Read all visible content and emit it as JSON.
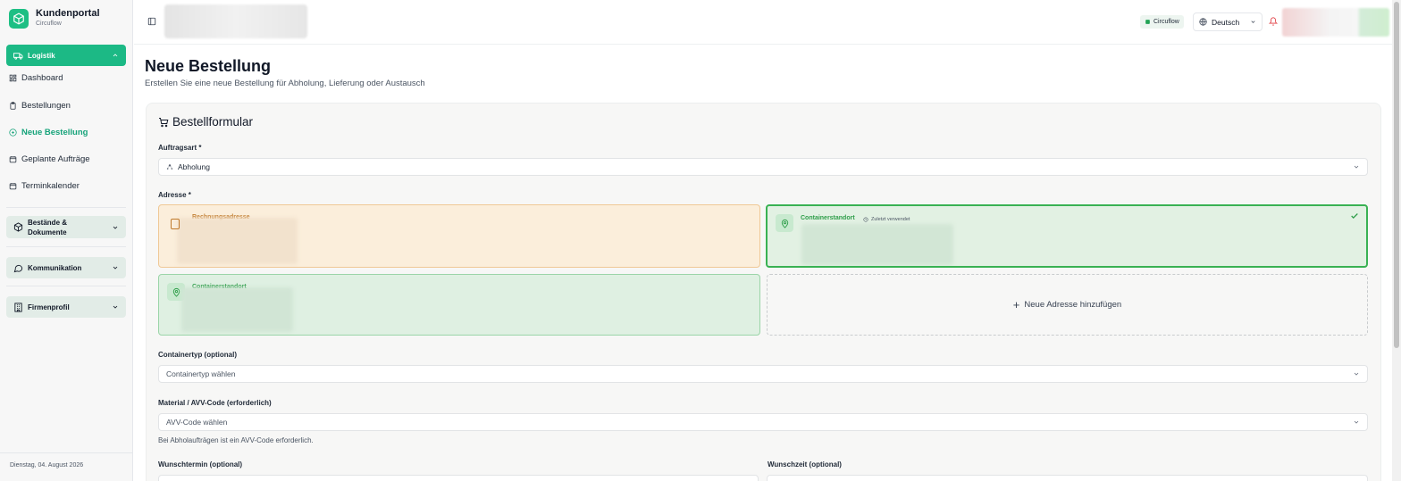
{
  "app": {
    "title": "Kundenportal",
    "subtitle": "Circuflow"
  },
  "sidebar": {
    "logistik_label": "Logistik",
    "items": [
      {
        "label": "Dashboard",
        "icon": "dashboard-icon"
      },
      {
        "label": "Bestellungen",
        "icon": "clipboard-icon"
      },
      {
        "label": "Neue Bestellung",
        "icon": "plus-circle-icon",
        "active": true
      },
      {
        "label": "Geplante Aufträge",
        "icon": "calendar-icon"
      },
      {
        "label": "Terminkalender",
        "icon": "calendar-icon"
      }
    ],
    "groups": [
      {
        "label": "Bestände & Dokumente",
        "line1": "Bestände &",
        "line2": "Dokumente",
        "icon": "box-icon"
      },
      {
        "label": "Kommunikation",
        "icon": "chat-icon"
      },
      {
        "label": "Firmenprofil",
        "icon": "building-icon"
      }
    ],
    "footer_date": "Dienstag, 04. August 2026"
  },
  "header": {
    "org_badge": "Circuflow",
    "language": "Deutsch"
  },
  "page": {
    "title": "Neue Bestellung",
    "subtitle": "Erstellen Sie eine neue Bestellung für Abholung, Lieferung oder Austausch"
  },
  "form": {
    "title": "Bestellformular",
    "auftragsart_label": "Auftragsart *",
    "auftragsart_value": "Abholung",
    "adresse_label": "Adresse *",
    "addresses": {
      "billing_label": "Rechnungsadresse",
      "selected_label": "Containerstandort",
      "recent_badge": "Zuletzt verwendet",
      "third_label": "Containerstandort",
      "add_new": "Neue Adresse hinzufügen"
    },
    "containertyp_label": "Containertyp (optional)",
    "containertyp_placeholder": "Containertyp wählen",
    "material_label": "Material / AVV-Code (erforderlich)",
    "material_placeholder": "AVV-Code wählen",
    "material_hint": "Bei Abholaufträgen ist ein AVV-Code erforderlich.",
    "wunschtermin_label": "Wunschtermin (optional)",
    "wunschzeit_label": "Wunschzeit (optional)"
  },
  "colors": {
    "accent": "#1cb985",
    "accent_text": "#16a37a",
    "selected_border": "#39b253",
    "billing_bg": "#fbeedb"
  }
}
